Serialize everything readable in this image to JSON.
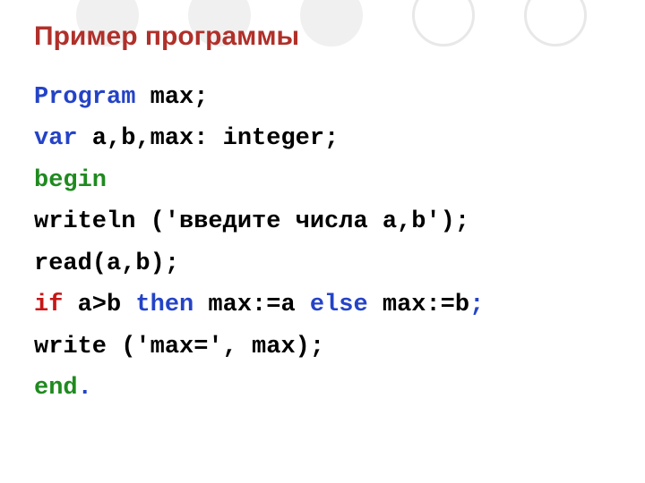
{
  "title": "Пример программы",
  "code": {
    "l1_kw": "Program",
    "l1_rest": " max;",
    "l2_kw": "var",
    "l2_rest": " a,b,max: integer;",
    "l3_kw": "begin",
    "l4": "writeln ('введите числа a,b');",
    "l5": "read(a,b);",
    "l6_if": "if",
    "l6_a": " a>b ",
    "l6_then": "then",
    "l6_b": " max:=a ",
    "l6_else": "else",
    "l6_c": " max:=b",
    "l6_semi": ";",
    "l7": "write ('max=', max);",
    "l8_kw": "end",
    "l8_dot": "."
  }
}
